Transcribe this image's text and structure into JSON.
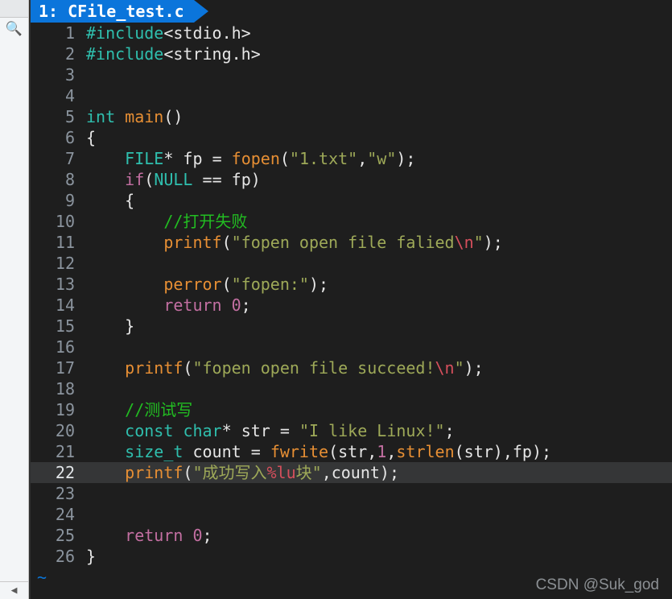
{
  "tab": {
    "index": "1:",
    "filename": "CFile_test.c"
  },
  "watermark": "CSDN @Suk_god",
  "tilde": "~",
  "left": {
    "search_glyph": "🔍",
    "arrow_glyph": "◀"
  },
  "code": {
    "lines": [
      {
        "n": 1,
        "seg": [
          [
            "c-hash",
            "#include"
          ],
          [
            "c-white",
            "<stdio.h>"
          ]
        ]
      },
      {
        "n": 2,
        "seg": [
          [
            "c-hash",
            "#include"
          ],
          [
            "c-white",
            "<string.h>"
          ]
        ]
      },
      {
        "n": 3,
        "seg": []
      },
      {
        "n": 4,
        "seg": []
      },
      {
        "n": 5,
        "seg": [
          [
            "c-tea",
            "int "
          ],
          [
            "c-func",
            "main"
          ],
          [
            "c-white",
            "()"
          ]
        ]
      },
      {
        "n": 6,
        "seg": [
          [
            "c-white",
            "{"
          ]
        ]
      },
      {
        "n": 7,
        "seg": [
          [
            "c-white",
            "    "
          ],
          [
            "c-tea",
            "FILE"
          ],
          [
            "c-white",
            "* fp "
          ],
          [
            "c-op",
            "="
          ],
          [
            "c-white",
            " "
          ],
          [
            "c-func",
            "fopen"
          ],
          [
            "c-white",
            "("
          ],
          [
            "c-str",
            "\"1.txt\""
          ],
          [
            "c-white",
            ","
          ],
          [
            "c-str",
            "\"w\""
          ],
          [
            "c-white",
            ");"
          ]
        ]
      },
      {
        "n": 8,
        "seg": [
          [
            "c-white",
            "    "
          ],
          [
            "c-ret",
            "if"
          ],
          [
            "c-white",
            "("
          ],
          [
            "c-tea",
            "NULL"
          ],
          [
            "c-white",
            " "
          ],
          [
            "c-op",
            "=="
          ],
          [
            "c-white",
            " fp)"
          ]
        ]
      },
      {
        "n": 9,
        "seg": [
          [
            "c-white",
            "    {"
          ]
        ]
      },
      {
        "n": 10,
        "seg": [
          [
            "c-white",
            "        "
          ],
          [
            "c-cmt",
            "//打开失败"
          ]
        ]
      },
      {
        "n": 11,
        "seg": [
          [
            "c-white",
            "        "
          ],
          [
            "c-func",
            "printf"
          ],
          [
            "c-white",
            "("
          ],
          [
            "c-str",
            "\"fopen open file falied"
          ],
          [
            "c-esc",
            "\\n"
          ],
          [
            "c-str",
            "\""
          ],
          [
            "c-white",
            ");"
          ]
        ]
      },
      {
        "n": 12,
        "seg": []
      },
      {
        "n": 13,
        "seg": [
          [
            "c-white",
            "        "
          ],
          [
            "c-func",
            "perror"
          ],
          [
            "c-white",
            "("
          ],
          [
            "c-str",
            "\"fopen:\""
          ],
          [
            "c-white",
            ");"
          ]
        ]
      },
      {
        "n": 14,
        "seg": [
          [
            "c-white",
            "        "
          ],
          [
            "c-ret",
            "return"
          ],
          [
            "c-white",
            " "
          ],
          [
            "c-num",
            "0"
          ],
          [
            "c-white",
            ";"
          ]
        ]
      },
      {
        "n": 15,
        "seg": [
          [
            "c-white",
            "    }"
          ]
        ]
      },
      {
        "n": 16,
        "seg": []
      },
      {
        "n": 17,
        "seg": [
          [
            "c-white",
            "    "
          ],
          [
            "c-func",
            "printf"
          ],
          [
            "c-white",
            "("
          ],
          [
            "c-str",
            "\"fopen open file succeed!"
          ],
          [
            "c-esc",
            "\\n"
          ],
          [
            "c-str",
            "\""
          ],
          [
            "c-white",
            ");"
          ]
        ]
      },
      {
        "n": 18,
        "seg": []
      },
      {
        "n": 19,
        "seg": [
          [
            "c-white",
            "    "
          ],
          [
            "c-cmt",
            "//测试写"
          ]
        ]
      },
      {
        "n": 20,
        "seg": [
          [
            "c-white",
            "    "
          ],
          [
            "c-tea",
            "const"
          ],
          [
            "c-white",
            " "
          ],
          [
            "c-tea",
            "char"
          ],
          [
            "c-white",
            "* str "
          ],
          [
            "c-op",
            "="
          ],
          [
            "c-white",
            " "
          ],
          [
            "c-str",
            "\"I like Linux!\""
          ],
          [
            "c-white",
            ";"
          ]
        ]
      },
      {
        "n": 21,
        "seg": [
          [
            "c-white",
            "    "
          ],
          [
            "c-tea",
            "size_t"
          ],
          [
            "c-white",
            " count "
          ],
          [
            "c-op",
            "="
          ],
          [
            "c-white",
            " "
          ],
          [
            "c-func",
            "fwrite"
          ],
          [
            "c-white",
            "(str,"
          ],
          [
            "c-num",
            "1"
          ],
          [
            "c-white",
            ","
          ],
          [
            "c-func",
            "strlen"
          ],
          [
            "c-white",
            "(str),fp);"
          ]
        ]
      },
      {
        "n": 22,
        "active": true,
        "seg": [
          [
            "c-white",
            "    "
          ],
          [
            "c-func",
            "printf"
          ],
          [
            "c-white",
            "("
          ],
          [
            "c-str",
            "\"成功写入"
          ],
          [
            "c-esc",
            "%lu"
          ],
          [
            "c-str",
            "块\""
          ],
          [
            "c-white",
            ",count);"
          ]
        ]
      },
      {
        "n": 23,
        "seg": []
      },
      {
        "n": 24,
        "seg": []
      },
      {
        "n": 25,
        "seg": [
          [
            "c-white",
            "    "
          ],
          [
            "c-ret",
            "return"
          ],
          [
            "c-white",
            " "
          ],
          [
            "c-num",
            "0"
          ],
          [
            "c-white",
            ";"
          ]
        ]
      },
      {
        "n": 26,
        "seg": [
          [
            "c-white",
            "}"
          ]
        ]
      }
    ]
  }
}
